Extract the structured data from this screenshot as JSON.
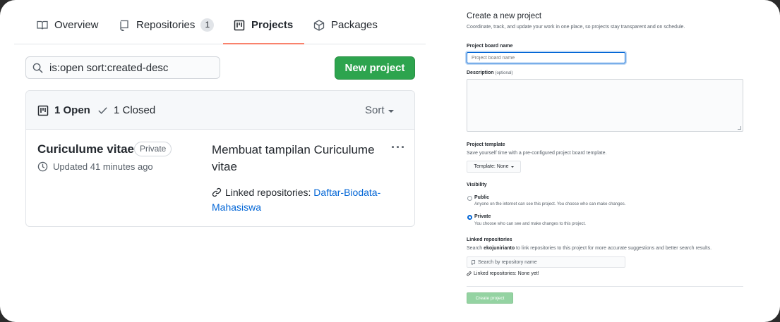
{
  "tabs": [
    {
      "label": "Overview",
      "icon": "book-icon"
    },
    {
      "label": "Repositories",
      "icon": "repo-icon",
      "count": "1"
    },
    {
      "label": "Projects",
      "icon": "project-icon",
      "active": true
    },
    {
      "label": "Packages",
      "icon": "package-icon"
    }
  ],
  "search": {
    "value": "is:open sort:created-desc"
  },
  "new_project_label": "New project",
  "filters": {
    "open_label": "1 Open",
    "closed_label": "1 Closed",
    "sort_label": "Sort"
  },
  "project": {
    "title": "Curiculume vitae",
    "visibility": "Private",
    "updated": "Updated 41 minutes ago",
    "description": "Membuat tampilan Curiculume vitae",
    "linked_prefix": "Linked repositories:",
    "linked_repo": "Daftar-Biodata-Mahasiswa",
    "menu_label": "···"
  },
  "form": {
    "title": "Create a new project",
    "subtitle": "Coordinate, track, and update your work in one place, so projects stay transparent and on schedule.",
    "name_label": "Project board name",
    "name_placeholder": "Project board name",
    "desc_label": "Description",
    "desc_optional": "(optional)",
    "template_label": "Project template",
    "template_note": "Save yourself time with a pre-configured project board template.",
    "template_button": "Template: None",
    "visibility_label": "Visibility",
    "public_label": "Public",
    "public_note": "Anyone on the internet can see this project. You choose who can make changes.",
    "private_label": "Private",
    "private_note": "You choose who can see and make changes to this project.",
    "linked_label": "Linked repositories",
    "linked_note_prefix": "Search",
    "linked_note_user": "ekojunirianto",
    "linked_note_suffix": "to link repositories to this project for more accurate suggestions and better search results.",
    "repo_search_placeholder": "Search by repository name",
    "linked_status": "Linked repositories: None yet!",
    "create_button": "Create project"
  },
  "colors": {
    "accent": "#2da44e",
    "tab_underline": "#f9826c",
    "link": "#0366d6"
  }
}
